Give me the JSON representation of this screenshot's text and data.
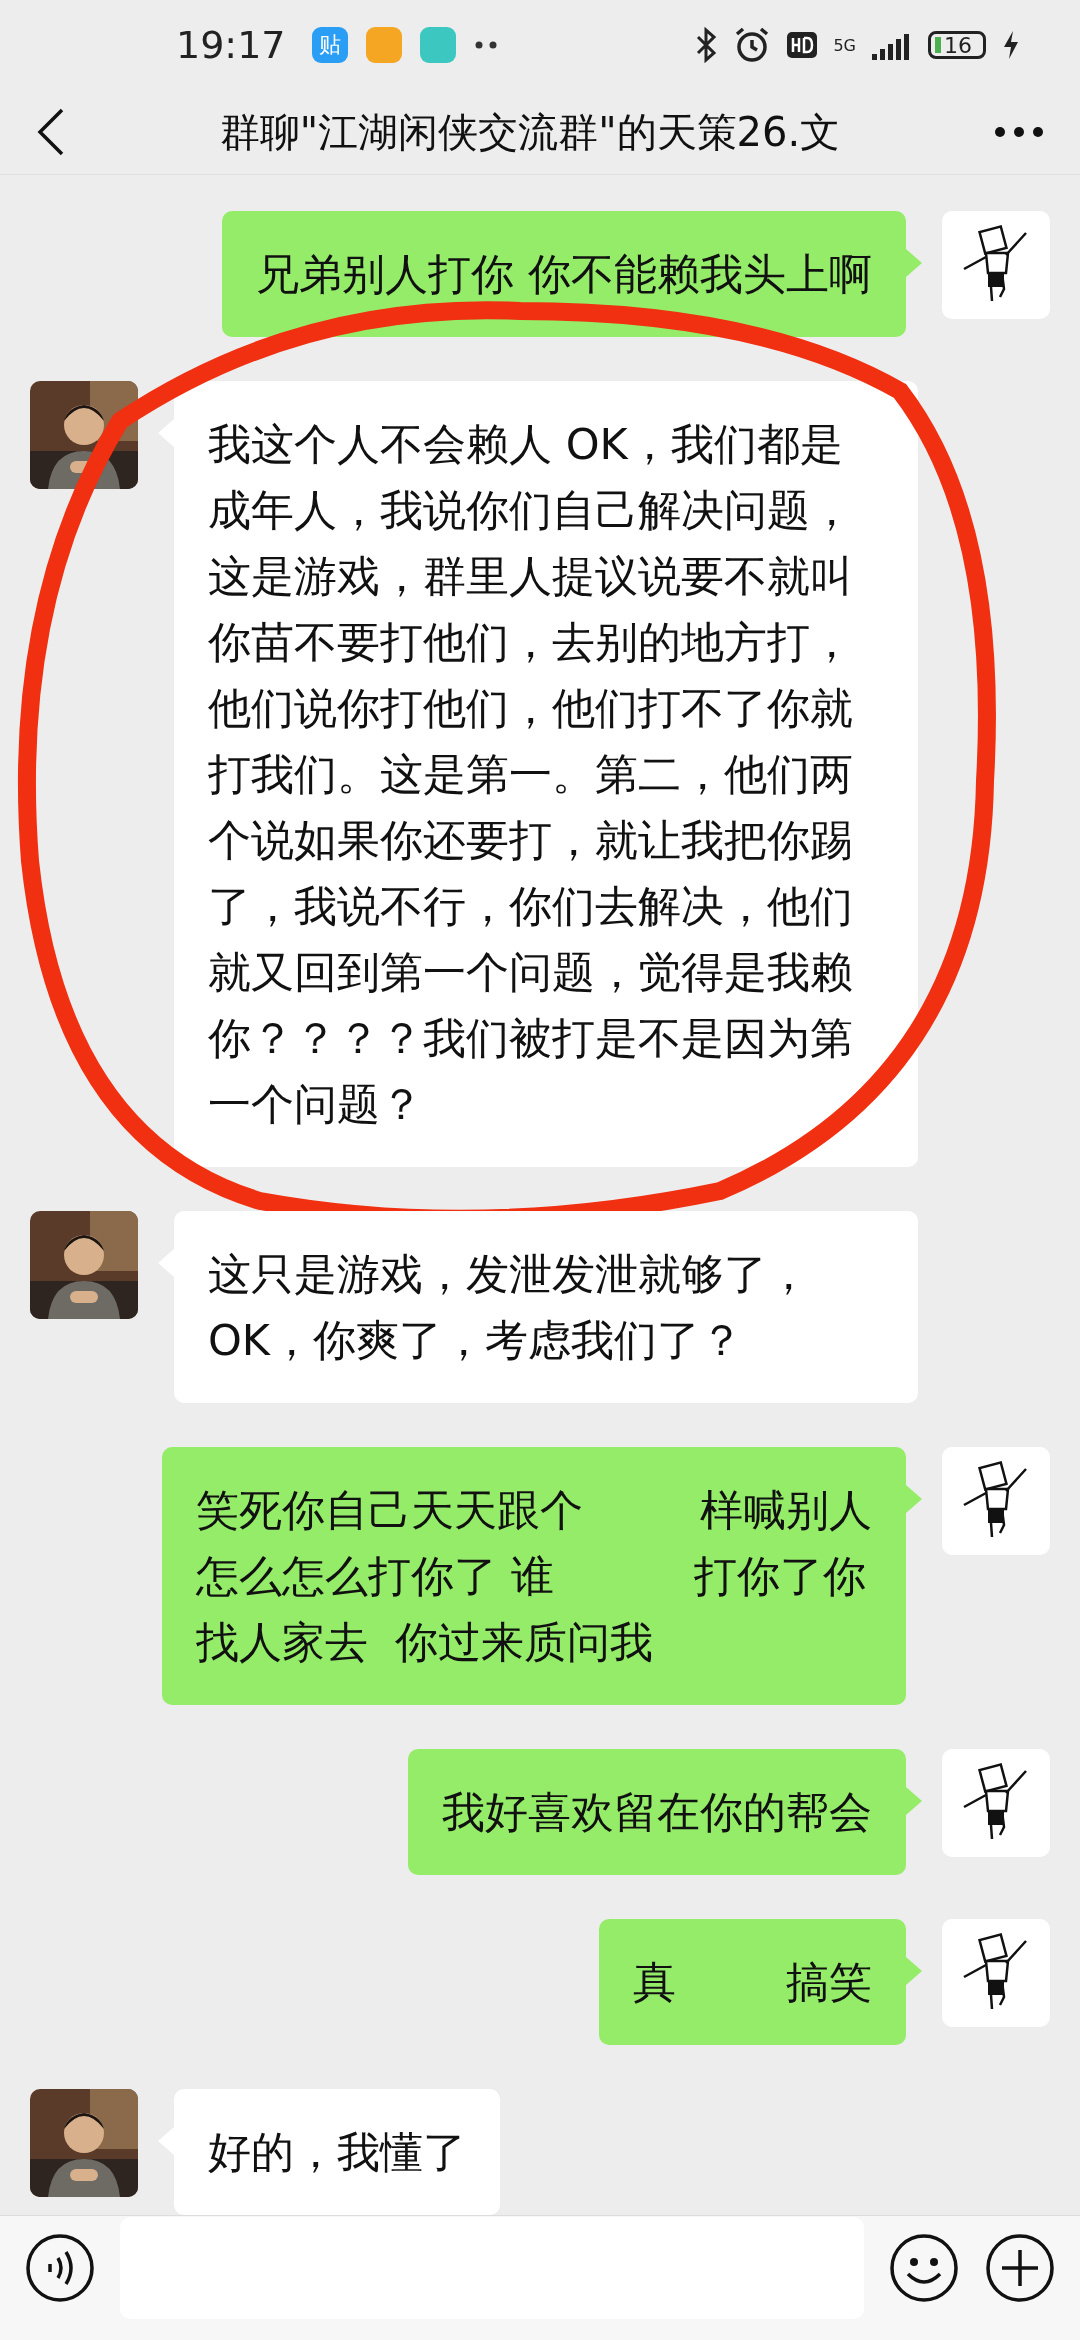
{
  "status_bar": {
    "time": "19:17",
    "app_badge": "贴",
    "battery": "16",
    "network": "5G"
  },
  "header": {
    "title": "群聊\"江湖闲侠交流群\"的天策26.文"
  },
  "messages": [
    {
      "outgoing": true,
      "kind": "text",
      "text": "兄弟别人打你 你不能赖我头上啊"
    },
    {
      "outgoing": false,
      "kind": "text",
      "circled": true,
      "text": "我这个人不会赖人 OK，我们都是成年人，我说你们自己解决问题，这是游戏，群里人提议说要不就叫你苗不要打他们，去别的地方打，他们说你打他们，他们打不了你就打我们。这是第一。第二，他们两个说如果你还要打，就让我把你踢了，我说不行，你们去解决，他们就又回到第一个问题，觉得是我赖你？？？？我们被打是不是因为第一个问题？"
    },
    {
      "outgoing": false,
      "kind": "text",
      "circled": false,
      "text": "这只是游戏，发泄发泄就够了，OK，你爽了，考虑我们了？"
    },
    {
      "outgoing": true,
      "kind": "redacted",
      "lines": [
        [
          "笑死你自己天天跟个",
          "样喊别人"
        ],
        [
          "怎么怎么打你了 谁",
          "打你了你"
        ],
        [
          "找人家去  你过来质问我"
        ]
      ]
    },
    {
      "outgoing": true,
      "kind": "text",
      "text": "我好喜欢留在你的帮会"
    },
    {
      "outgoing": true,
      "kind": "redacted",
      "lines": [
        [
          "真",
          "搞笑"
        ]
      ]
    },
    {
      "outgoing": false,
      "kind": "text",
      "circled": false,
      "text": "好的，我懂了"
    }
  ]
}
